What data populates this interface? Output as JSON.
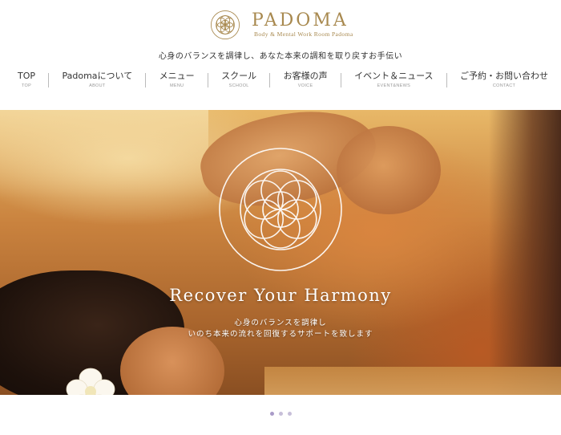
{
  "brand": {
    "name": "PADOMA",
    "subtitle": "Body & Mental Work Room Padoma",
    "tagline": "心身のバランスを調律し、あなた本来の調和を取り戻すお手伝い",
    "accent_color": "#a8894f"
  },
  "nav": {
    "items": [
      {
        "label": "TOP",
        "sub": "TOP"
      },
      {
        "label": "Padomaについて",
        "sub": "ABOUT"
      },
      {
        "label": "メニュー",
        "sub": "MENU"
      },
      {
        "label": "スクール",
        "sub": "SCHOOL"
      },
      {
        "label": "お客様の声",
        "sub": "VOICE"
      },
      {
        "label": "イベント＆ニュース",
        "sub": "EVENT&NEWS"
      },
      {
        "label": "ご予約・お問い合わせ",
        "sub": "CONTACT"
      }
    ]
  },
  "hero": {
    "title": "Recover Your Harmony",
    "line1": "心身のバランスを調律し",
    "line2": "いのち本来の流れを回復するサポートを致します",
    "logo_icon": "lotus-mandala-icon"
  },
  "slider": {
    "dot_count": 3,
    "active_index": 0,
    "dot_color": "#c7bfd9"
  }
}
